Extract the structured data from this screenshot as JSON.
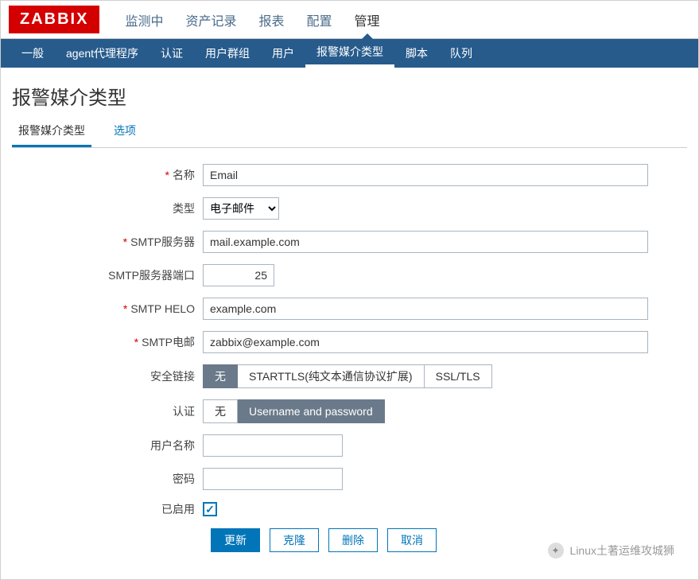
{
  "brand": "ZABBIX",
  "topnav": [
    {
      "label": "监测中"
    },
    {
      "label": "资产记录"
    },
    {
      "label": "报表"
    },
    {
      "label": "配置"
    },
    {
      "label": "管理",
      "active": true
    }
  ],
  "subnav": [
    {
      "label": "一般"
    },
    {
      "label": "agent代理程序"
    },
    {
      "label": "认证"
    },
    {
      "label": "用户群组"
    },
    {
      "label": "用户"
    },
    {
      "label": "报警媒介类型",
      "active": true
    },
    {
      "label": "脚本"
    },
    {
      "label": "队列"
    }
  ],
  "page_title": "报警媒介类型",
  "tabs": [
    {
      "label": "报警媒介类型",
      "active": true
    },
    {
      "label": "选项"
    }
  ],
  "form": {
    "name_label": "名称",
    "name_value": "Email",
    "type_label": "类型",
    "type_value": "电子邮件",
    "smtp_server_label": "SMTP服务器",
    "smtp_server_value": "mail.example.com",
    "smtp_port_label": "SMTP服务器端口",
    "smtp_port_value": "25",
    "smtp_helo_label": "SMTP HELO",
    "smtp_helo_value": "example.com",
    "smtp_email_label": "SMTP电邮",
    "smtp_email_value": "zabbix@example.com",
    "security_label": "安全链接",
    "security_options": [
      "无",
      "STARTTLS(纯文本通信协议扩展)",
      "SSL/TLS"
    ],
    "auth_label": "认证",
    "auth_options": [
      "无",
      "Username and password"
    ],
    "username_label": "用户名称",
    "username_value": "",
    "password_label": "密码",
    "password_value": "",
    "enabled_label": "已启用",
    "enabled_value": true
  },
  "buttons": {
    "update": "更新",
    "clone": "克隆",
    "delete": "删除",
    "cancel": "取消"
  },
  "watermark": "Linux土著运维攻城狮"
}
